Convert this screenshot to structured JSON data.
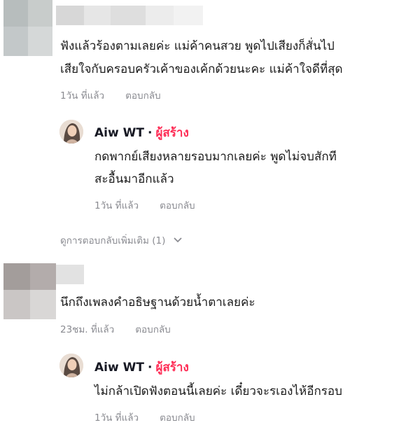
{
  "comments": [
    {
      "text_line1": "ฟังแล้วร้องตามเลยค่ะ แม่ค้าคนสวย พูดไปเสียงก็สั่นไป",
      "text_line2": "เสียใจกับครอบครัวเค้าของเค้กด้วยนะคะ แม่ค้าใจดีที่สุด",
      "time": "1วัน ที่แล้ว",
      "reply_label": "ตอบกลับ",
      "reply": {
        "author": "Aiw WT",
        "separator": "·",
        "creator_badge": "ผู้สร้าง",
        "text_line1": "กดพากย์เสียงหลายรอบมากเลยค่ะ พูดไม่จบสักที",
        "text_line2": "สะอื้นมาอีกแล้ว",
        "time": "1วัน ที่แล้ว",
        "reply_label": "ตอบกลับ"
      },
      "more_replies": "ดูการตอบกลับเพิ่มเติม (1)"
    },
    {
      "text_line1": "นึกถึงเพลงคำอธิษฐานด้วยน้ำตาเลยค่ะ",
      "time": "23ชม. ที่แล้ว",
      "reply_label": "ตอบกลับ",
      "reply": {
        "author": "Aiw WT",
        "separator": "·",
        "creator_badge": "ผู้สร้าง",
        "text_line1": "ไม่กล้าเปิดฟังตอนนี้เลยค่ะ เดี๋ยวจะรเองไห้อีกรอบ",
        "time": "1วัน ที่แล้ว",
        "reply_label": "ตอบกลับ"
      }
    }
  ],
  "colors": {
    "creator_accent": "#fe2c55",
    "meta_gray": "#8a8b91"
  },
  "icons": {
    "more_chevron": "chevron-down-icon"
  }
}
